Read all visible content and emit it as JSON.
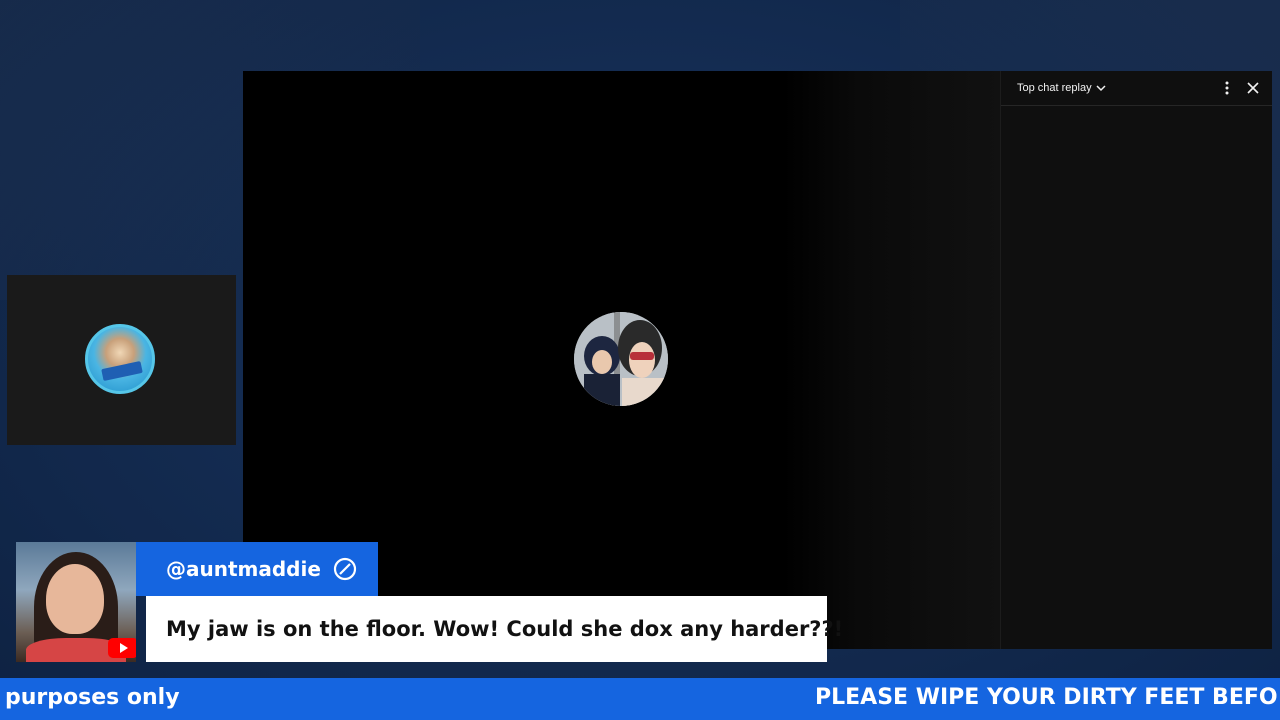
{
  "chat": {
    "title": "Top chat replay",
    "chevron_icon": "chevron-down-icon",
    "more_icon": "more-vert-icon",
    "close_icon": "close-icon"
  },
  "comment": {
    "username": "@auntmaddie",
    "message": "My jaw is on the floor. Wow! Could she dox any harder??!",
    "platform_icon": "youtube-icon",
    "badge_icon": "block-icon"
  },
  "ticker": {
    "segment_1": "purposes only",
    "segment_2": "PLEASE WIPE YOUR DIRTY FEET BEFO"
  },
  "colors": {
    "background": "#142c52",
    "accent_blue": "#1565e0",
    "panel": "#0f0f0f",
    "message_bg": "#ffffff"
  }
}
